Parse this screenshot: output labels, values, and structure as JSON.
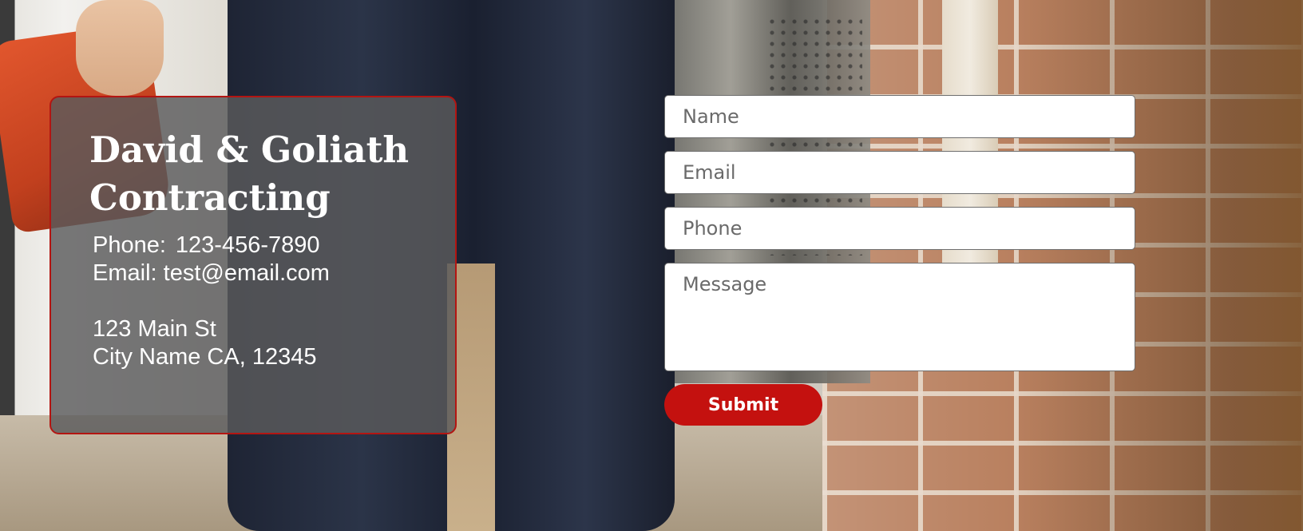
{
  "company": {
    "name_line1": "David & Goliath",
    "name_line2": "Contracting"
  },
  "contact": {
    "phone_label": "Phone:",
    "phone_value": "123-456-7890",
    "email_label": "Email:",
    "email_value": "test@email.com",
    "address_line1": "123 Main St",
    "address_line2": "City Name CA, 12345"
  },
  "form": {
    "name_placeholder": "Name",
    "email_placeholder": "Email",
    "phone_placeholder": "Phone",
    "message_placeholder": "Message",
    "submit_label": "Submit"
  },
  "colors": {
    "accent": "#c4110f",
    "panel": "#5a5a5c"
  }
}
